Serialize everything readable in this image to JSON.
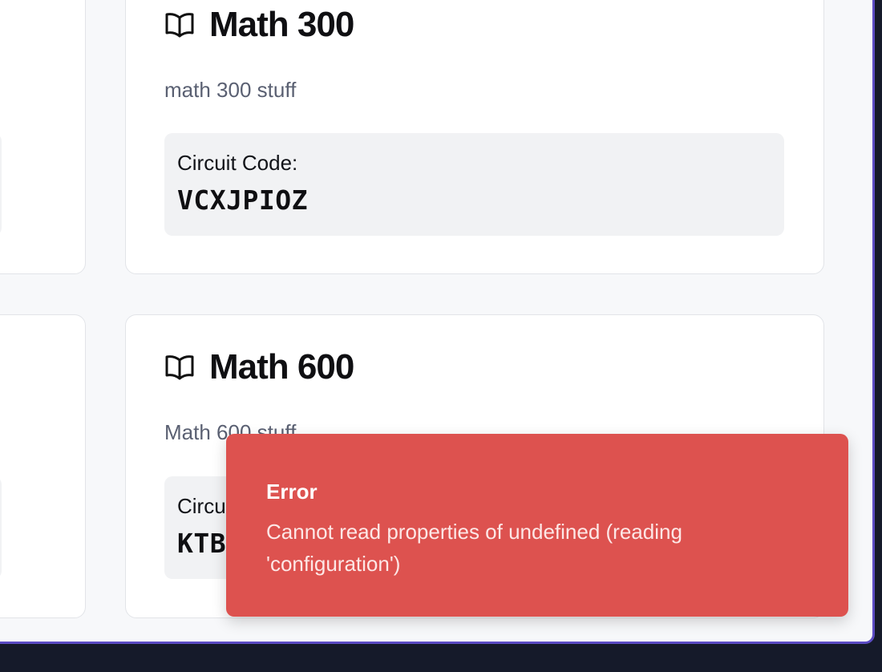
{
  "courses": [
    {
      "title": "Math 300",
      "description": "math 300 stuff",
      "code_label": "Circuit Code:",
      "code": "VCXJPIOZ"
    },
    {
      "title": "Math 600",
      "description": "Math 600 stuff",
      "code_label": "Circuit Code:",
      "code": "KTB"
    }
  ],
  "toast": {
    "title": "Error",
    "message": "Cannot read properties of undefined (reading 'configuration')"
  },
  "colors": {
    "frame_border": "#5b4bc4",
    "toast_bg": "#dd524f",
    "desktop_bg": "#151a2a"
  }
}
